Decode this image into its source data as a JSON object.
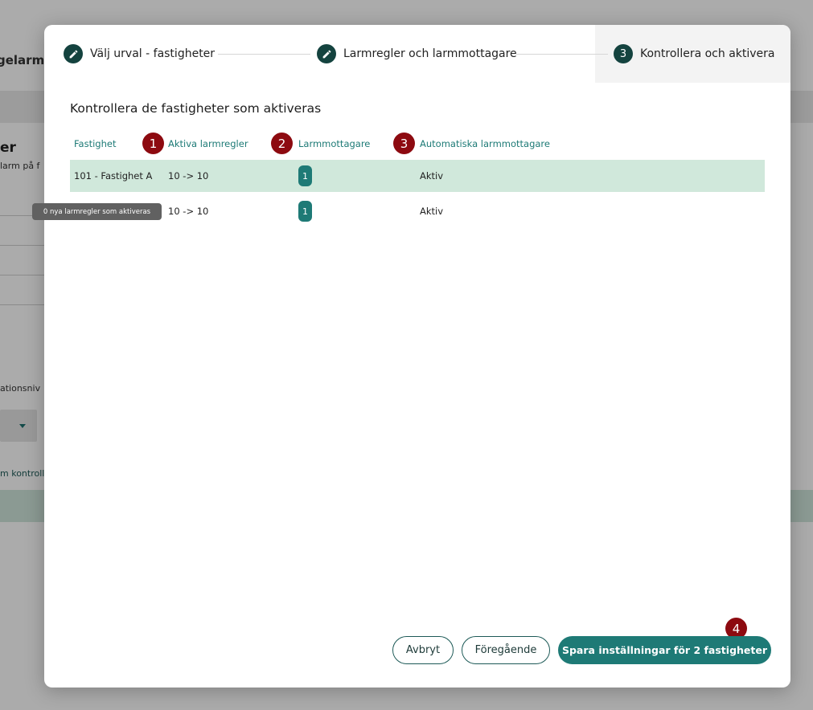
{
  "background": {
    "title_fragment": "gelarm",
    "heading_fragment": "er",
    "subtext_fragment": "larm på f",
    "label_fragment": "ationsniv",
    "link_fragment": "m kontroll"
  },
  "stepper": {
    "steps": [
      {
        "label": "Välj urval - fastigheter",
        "icon": "pencil-icon",
        "state": "done"
      },
      {
        "label": "Larmregler och larmmottagare",
        "icon": "pencil-icon",
        "state": "done"
      },
      {
        "label": "Kontrollera och aktivera",
        "number": "3",
        "state": "active"
      }
    ]
  },
  "section_title": "Kontrollera de fastigheter som aktiveras",
  "table": {
    "columns": [
      "Fastighet",
      "Aktiva larmregler",
      "Larmmottagare",
      "Automatiska larmmottagare"
    ],
    "rows": [
      {
        "property": "101 - Fastighet A",
        "rules": "10 -> 10",
        "receivers": "1",
        "auto": "Aktiv"
      },
      {
        "property": "",
        "rules": "10 -> 10",
        "receivers": "1",
        "auto": "Aktiv"
      }
    ]
  },
  "markers": [
    "1",
    "2",
    "3",
    "4"
  ],
  "tooltip": "0 nya larmregler som aktiveras",
  "buttons": {
    "cancel": "Avbryt",
    "previous": "Föregående",
    "save": "Spara inställningar för 2 fastigheter"
  },
  "colors": {
    "accent": "#1e7a76",
    "dark_step": "#14433f",
    "highlight_row": "#d0e8db",
    "marker": "#8d0a10"
  }
}
